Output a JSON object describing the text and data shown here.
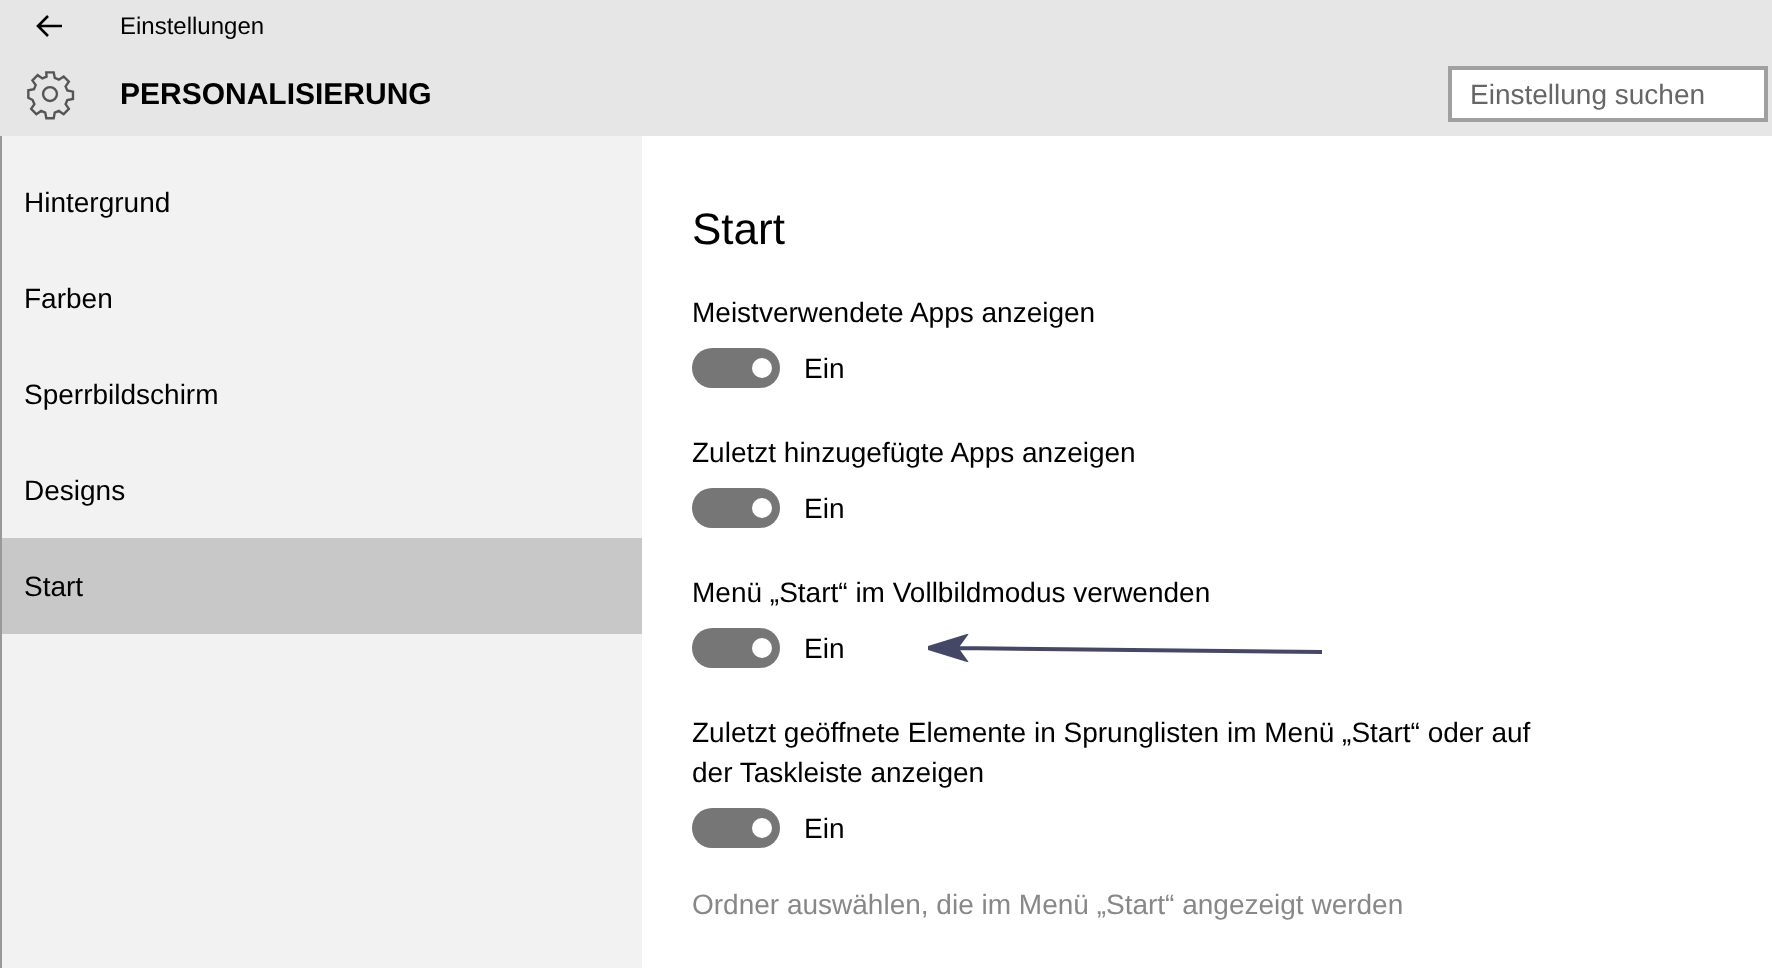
{
  "window": {
    "title": "Einstellungen"
  },
  "header": {
    "title": "PERSONALISIERUNG",
    "search": {
      "placeholder": "Einstellung suchen"
    }
  },
  "sidebar": {
    "items": [
      {
        "label": "Hintergrund",
        "selected": false
      },
      {
        "label": "Farben",
        "selected": false
      },
      {
        "label": "Sperrbildschirm",
        "selected": false
      },
      {
        "label": "Designs",
        "selected": false
      },
      {
        "label": "Start",
        "selected": true
      }
    ]
  },
  "content": {
    "title": "Start",
    "settings": [
      {
        "label": "Meistverwendete Apps anzeigen",
        "on": true,
        "state_text": "Ein"
      },
      {
        "label": "Zuletzt hinzugefügte Apps anzeigen",
        "on": true,
        "state_text": "Ein"
      },
      {
        "label": "Menü „Start“ im Vollbildmodus verwenden",
        "on": true,
        "state_text": "Ein",
        "arrow": true
      },
      {
        "label": "Zuletzt geöffnete Elemente in Sprunglisten im Menü „Start“ oder auf der Taskleiste anzeigen",
        "on": true,
        "state_text": "Ein"
      }
    ],
    "link": "Ordner auswählen, die im Menü „Start“ angezeigt werden"
  }
}
